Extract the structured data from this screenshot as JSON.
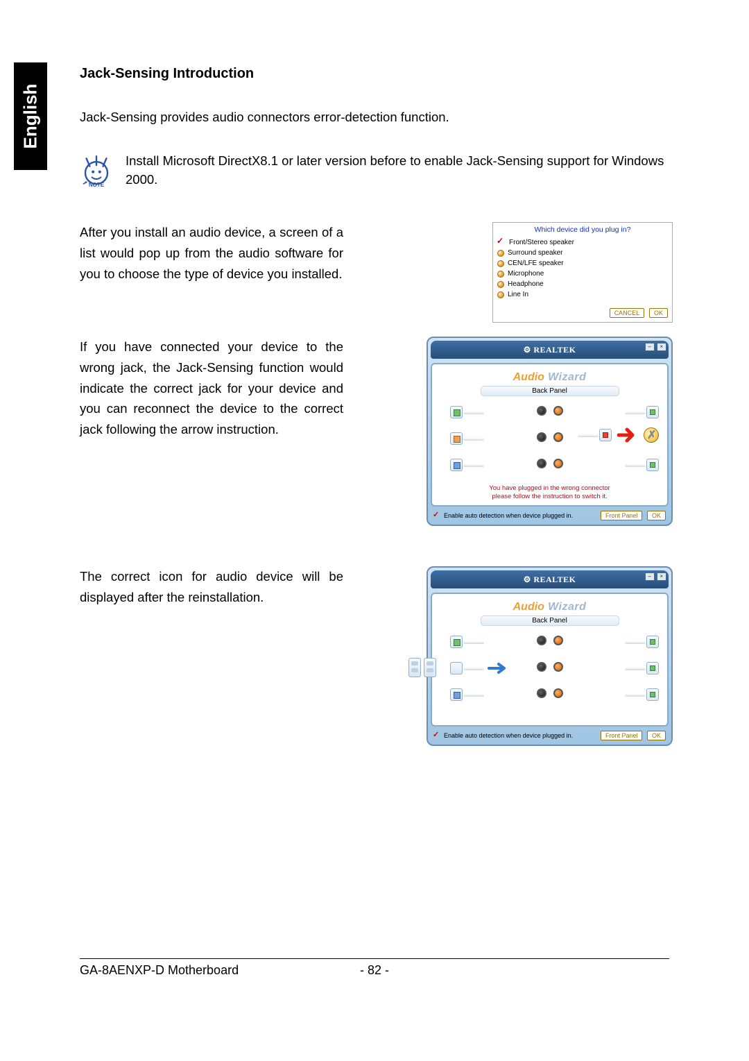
{
  "side_tab": "English",
  "section_title": "Jack-Sensing Introduction",
  "intro": "Jack-Sensing provides audio connectors error-detection function.",
  "note_label": "NOTE",
  "note_text": "Install Microsoft DirectX8.1 or later version before to enable Jack-Sensing support for Windows 2000.",
  "block1_text": "After you install an audio device, a screen of a list would pop up from the audio software for you to choose the type of device you installed.",
  "block2_text": "If you have connected your device to the wrong jack, the Jack-Sensing function would indicate the correct jack for your device and you can reconnect the device to the correct jack following the arrow instruction.",
  "block3_text": "The correct icon for audio device will be displayed after the reinstallation.",
  "dialog": {
    "question": "Which device did you plug in?",
    "options": [
      "Front/Stereo speaker",
      "Surround speaker",
      "CEN/LFE speaker",
      "Microphone",
      "Headphone",
      "Line In"
    ],
    "cancel": "CANCEL",
    "ok": "OK"
  },
  "wizard": {
    "brand": "REALTEK",
    "title_a": "Audio",
    "title_b": "Wizard",
    "subtitle": "Back Panel",
    "wrong_msg_1": "You have plugged in the wrong connector",
    "wrong_msg_2": "please follow the instruction to switch it.",
    "enable_label": "Enable auto detection when device plugged in.",
    "front_panel": "Front Panel",
    "ok": "OK"
  },
  "footer": {
    "doc": "GA-8AENXP-D Motherboard",
    "page": "- 82 -"
  }
}
